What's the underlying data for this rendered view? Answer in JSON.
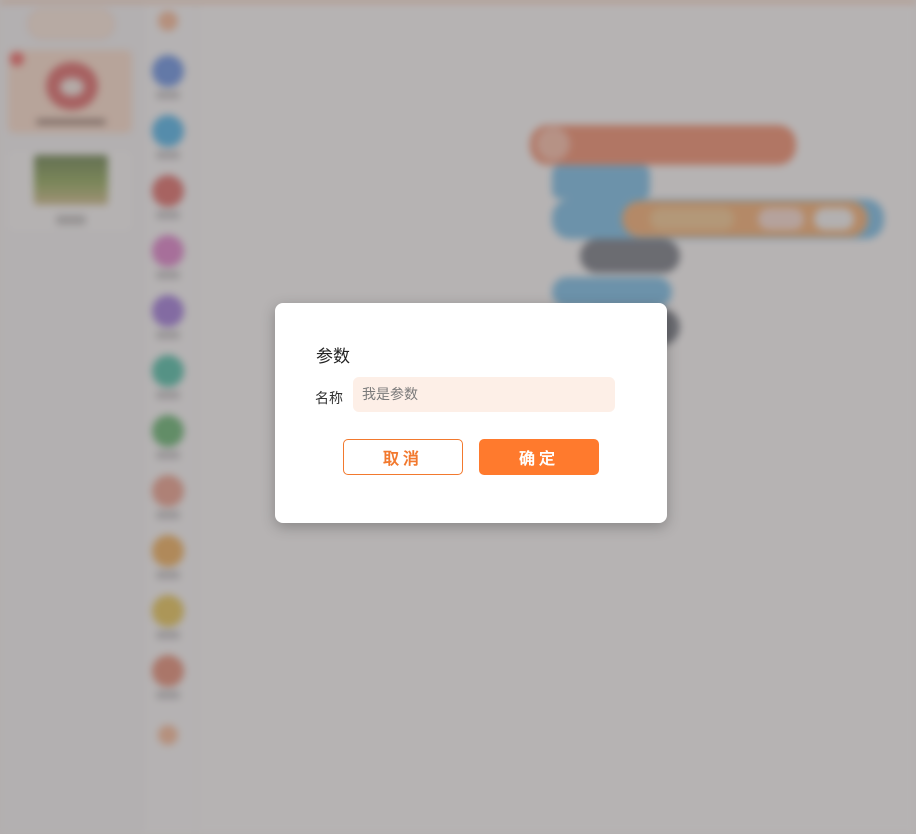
{
  "dialog": {
    "title": "参数",
    "name_label": "名称",
    "name_placeholder": "我是参数",
    "name_value": "",
    "cancel_label": "取消",
    "confirm_label": "确定"
  },
  "colors": {
    "accent": "#ff7a2d",
    "input_bg": "#fdefe7"
  },
  "palette": {
    "categories": [
      {
        "icon": "motion-category-icon",
        "color": "#4c7fe0"
      },
      {
        "icon": "looks-category-icon",
        "color": "#2fa8e8"
      },
      {
        "icon": "sound-category-icon",
        "color": "#d9534f"
      },
      {
        "icon": "pen-category-icon",
        "color": "#d96cc4"
      },
      {
        "icon": "data-category-icon",
        "color": "#8e63d6"
      },
      {
        "icon": "events-category-icon",
        "color": "#2fb59a"
      },
      {
        "icon": "control-category-icon",
        "color": "#4aa95a"
      },
      {
        "icon": "sensing-category-icon",
        "color": "#e8907a"
      },
      {
        "icon": "operators-category-icon",
        "color": "#eda23f"
      },
      {
        "icon": "variables-category-icon",
        "color": "#e3bd3b"
      },
      {
        "icon": "my-blocks-category-icon",
        "color": "#e07a5f"
      }
    ]
  }
}
